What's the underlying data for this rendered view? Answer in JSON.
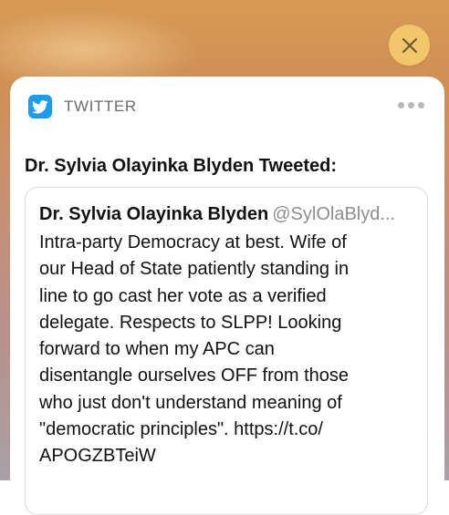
{
  "notification": {
    "app_name": "TWITTER",
    "app_icon": "twitter-bird-icon",
    "title": "Dr. Sylvia Olayinka Blyden Tweeted:"
  },
  "tweet": {
    "author": "Dr. Sylvia Olayinka Blyden",
    "handle": "@SylOlaBlyd...",
    "lines": [
      "Intra-party Democracy at best. Wife of",
      "our Head of State patiently standing in",
      "line to go cast her vote as a verified",
      "delegate. Respects to SLPP! Looking",
      "forward to when my APC can",
      "disentangle ourselves OFF from those",
      "who just don't understand meaning of",
      "\"democratic principles\". https://t.co/",
      "APOGZBTeiW"
    ]
  },
  "controls": {
    "close_icon": "close-icon",
    "more_icon": "more-options-icon"
  },
  "colors": {
    "close_button_bg": "#f2c66a",
    "twitter_blue": "#1d9bf0",
    "handle_gray": "#8e8e8e"
  }
}
